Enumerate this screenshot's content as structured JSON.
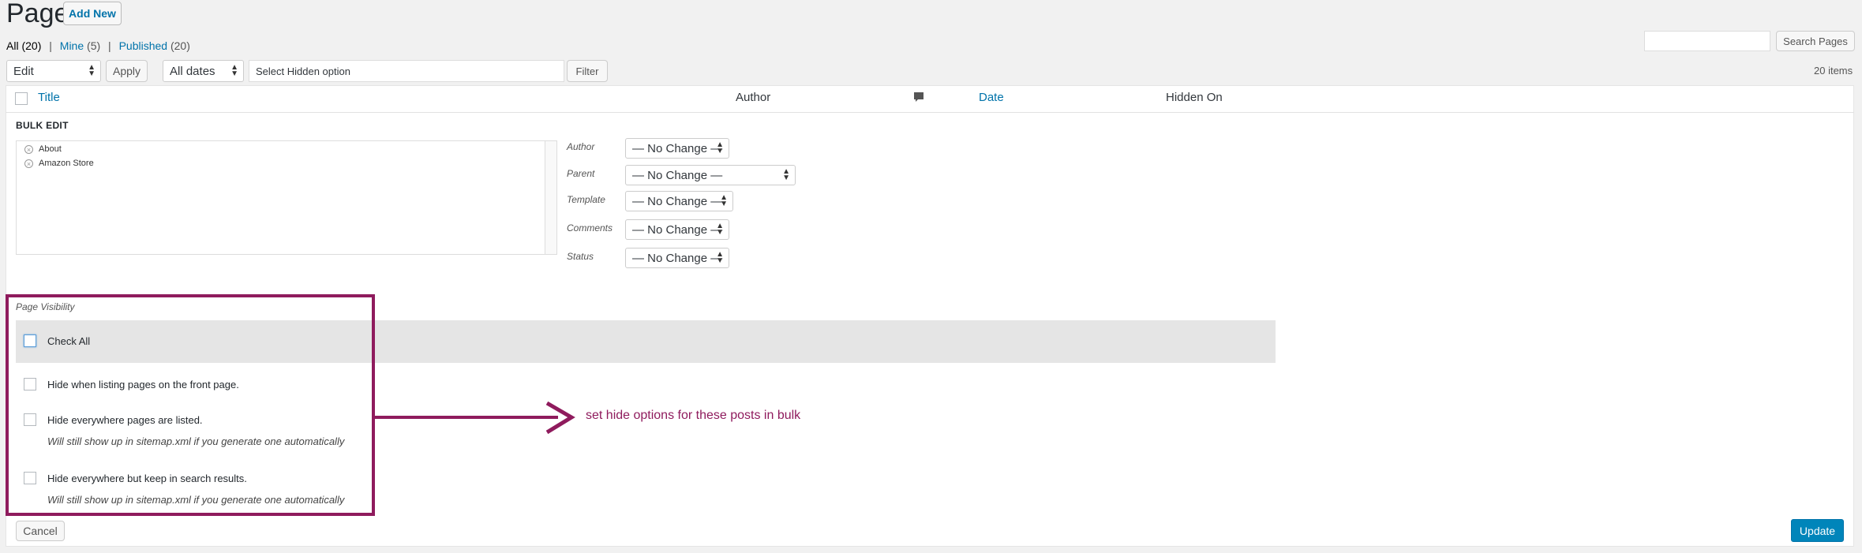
{
  "header": {
    "title": "Pages",
    "add_new": "Add New"
  },
  "subsubsub": {
    "all_label": "All",
    "all_count": "(20)",
    "mine_label": "Mine",
    "mine_count": "(5)",
    "published_label": "Published",
    "published_count": "(20)",
    "separator": "|"
  },
  "search": {
    "value": "",
    "button": "Search Pages"
  },
  "toolbar": {
    "bulk_action": "Edit",
    "apply": "Apply",
    "dates": "All dates",
    "hidden_option": "Select Hidden option",
    "filter": "Filter",
    "items_count": "20 items"
  },
  "table": {
    "columns": {
      "title": "Title",
      "author": "Author",
      "comments_icon": "comment-bubble-icon",
      "date": "Date",
      "hidden_on": "Hidden On"
    }
  },
  "bulk_edit": {
    "heading": "BULK EDIT",
    "pages": [
      "About",
      "Amazon Store"
    ],
    "remove_icon": "circle-x-icon",
    "fields": [
      {
        "label": "Author",
        "value": "— No Change —"
      },
      {
        "label": "Parent",
        "value": "— No Change —"
      },
      {
        "label": "Template",
        "value": "— No Change —"
      },
      {
        "label": "Comments",
        "value": "— No Change —"
      },
      {
        "label": "Status",
        "value": "— No Change —"
      }
    ]
  },
  "visibility": {
    "heading": "Page Visibility",
    "check_all": "Check All",
    "options": [
      {
        "label": "Hide when listing pages on the front page.",
        "note": ""
      },
      {
        "label": "Hide everywhere pages are listed.",
        "note": "Will still show up in sitemap.xml if you generate one automatically"
      },
      {
        "label": "Hide everywhere but keep in search results.",
        "note": "Will still show up in sitemap.xml if you generate one automatically"
      }
    ]
  },
  "annotation": {
    "text": "set hide options for these posts in bulk",
    "color": "#8f1b5d"
  },
  "footer": {
    "cancel": "Cancel",
    "update": "Update"
  }
}
